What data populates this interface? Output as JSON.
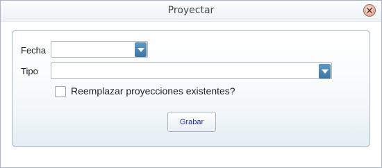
{
  "window": {
    "title": "Proyectar"
  },
  "form": {
    "fecha_label": "Fecha",
    "fecha_value": "",
    "tipo_label": "Tipo",
    "tipo_value": "",
    "checkbox_label": "Reemplazar proyecciones existentes?",
    "checkbox_checked": false,
    "save_label": "Grabar"
  },
  "icons": {
    "close": "close-icon",
    "dropdown": "chevron-down-icon"
  },
  "colors": {
    "dropdown_button": "#4a86b8",
    "save_text": "#1a2fb0"
  }
}
